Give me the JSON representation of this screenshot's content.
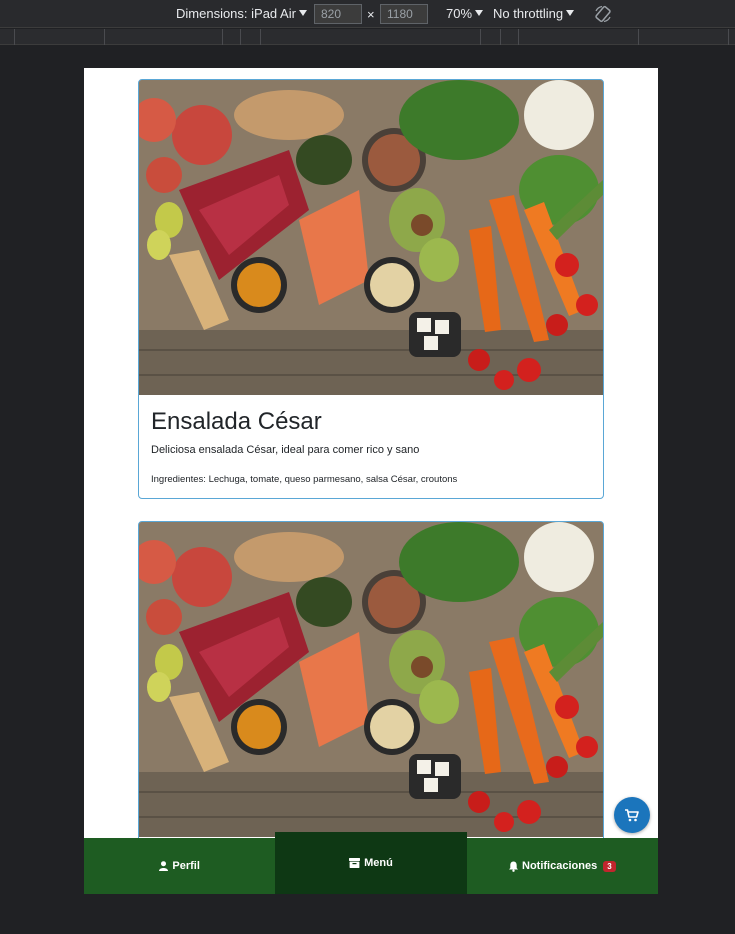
{
  "devtools": {
    "dimensions_label": "Dimensions: iPad Air",
    "width": "820",
    "height": "1180",
    "times": "×",
    "zoom": "70%",
    "throttling": "No throttling"
  },
  "cards": [
    {
      "title": "Ensalada César",
      "description": "Deliciosa ensalada César, ideal para comer rico y sano",
      "ingredients": "Ingredientes: Lechuga, tomate, queso parmesano, salsa César, croutons"
    },
    {
      "title": "",
      "description": "",
      "ingredients": ""
    }
  ],
  "nav": {
    "profile_label": "Perfil",
    "menu_label": "Menú",
    "notifications_label": "Notificaciones",
    "notifications_count": "3"
  },
  "icons": {
    "cart": "cart-icon",
    "profile": "user-icon",
    "menu": "menu-card-icon",
    "notifications": "bell-icon",
    "rotate": "rotate-icon"
  },
  "colors": {
    "nav_bg": "#1e5c22",
    "nav_active": "#0e3814",
    "card_border": "#5aa7d6",
    "cart_button": "#1b75bc",
    "badge": "#c0262d"
  }
}
